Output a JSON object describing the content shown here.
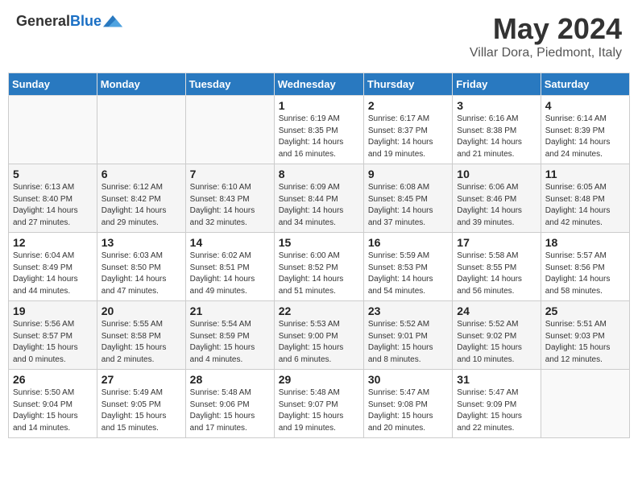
{
  "header": {
    "logo_line1": "General",
    "logo_line2": "Blue",
    "month": "May 2024",
    "location": "Villar Dora, Piedmont, Italy"
  },
  "weekdays": [
    "Sunday",
    "Monday",
    "Tuesday",
    "Wednesday",
    "Thursday",
    "Friday",
    "Saturday"
  ],
  "weeks": [
    [
      {
        "day": "",
        "info": ""
      },
      {
        "day": "",
        "info": ""
      },
      {
        "day": "",
        "info": ""
      },
      {
        "day": "1",
        "info": "Sunrise: 6:19 AM\nSunset: 8:35 PM\nDaylight: 14 hours\nand 16 minutes."
      },
      {
        "day": "2",
        "info": "Sunrise: 6:17 AM\nSunset: 8:37 PM\nDaylight: 14 hours\nand 19 minutes."
      },
      {
        "day": "3",
        "info": "Sunrise: 6:16 AM\nSunset: 8:38 PM\nDaylight: 14 hours\nand 21 minutes."
      },
      {
        "day": "4",
        "info": "Sunrise: 6:14 AM\nSunset: 8:39 PM\nDaylight: 14 hours\nand 24 minutes."
      }
    ],
    [
      {
        "day": "5",
        "info": "Sunrise: 6:13 AM\nSunset: 8:40 PM\nDaylight: 14 hours\nand 27 minutes."
      },
      {
        "day": "6",
        "info": "Sunrise: 6:12 AM\nSunset: 8:42 PM\nDaylight: 14 hours\nand 29 minutes."
      },
      {
        "day": "7",
        "info": "Sunrise: 6:10 AM\nSunset: 8:43 PM\nDaylight: 14 hours\nand 32 minutes."
      },
      {
        "day": "8",
        "info": "Sunrise: 6:09 AM\nSunset: 8:44 PM\nDaylight: 14 hours\nand 34 minutes."
      },
      {
        "day": "9",
        "info": "Sunrise: 6:08 AM\nSunset: 8:45 PM\nDaylight: 14 hours\nand 37 minutes."
      },
      {
        "day": "10",
        "info": "Sunrise: 6:06 AM\nSunset: 8:46 PM\nDaylight: 14 hours\nand 39 minutes."
      },
      {
        "day": "11",
        "info": "Sunrise: 6:05 AM\nSunset: 8:48 PM\nDaylight: 14 hours\nand 42 minutes."
      }
    ],
    [
      {
        "day": "12",
        "info": "Sunrise: 6:04 AM\nSunset: 8:49 PM\nDaylight: 14 hours\nand 44 minutes."
      },
      {
        "day": "13",
        "info": "Sunrise: 6:03 AM\nSunset: 8:50 PM\nDaylight: 14 hours\nand 47 minutes."
      },
      {
        "day": "14",
        "info": "Sunrise: 6:02 AM\nSunset: 8:51 PM\nDaylight: 14 hours\nand 49 minutes."
      },
      {
        "day": "15",
        "info": "Sunrise: 6:00 AM\nSunset: 8:52 PM\nDaylight: 14 hours\nand 51 minutes."
      },
      {
        "day": "16",
        "info": "Sunrise: 5:59 AM\nSunset: 8:53 PM\nDaylight: 14 hours\nand 54 minutes."
      },
      {
        "day": "17",
        "info": "Sunrise: 5:58 AM\nSunset: 8:55 PM\nDaylight: 14 hours\nand 56 minutes."
      },
      {
        "day": "18",
        "info": "Sunrise: 5:57 AM\nSunset: 8:56 PM\nDaylight: 14 hours\nand 58 minutes."
      }
    ],
    [
      {
        "day": "19",
        "info": "Sunrise: 5:56 AM\nSunset: 8:57 PM\nDaylight: 15 hours\nand 0 minutes."
      },
      {
        "day": "20",
        "info": "Sunrise: 5:55 AM\nSunset: 8:58 PM\nDaylight: 15 hours\nand 2 minutes."
      },
      {
        "day": "21",
        "info": "Sunrise: 5:54 AM\nSunset: 8:59 PM\nDaylight: 15 hours\nand 4 minutes."
      },
      {
        "day": "22",
        "info": "Sunrise: 5:53 AM\nSunset: 9:00 PM\nDaylight: 15 hours\nand 6 minutes."
      },
      {
        "day": "23",
        "info": "Sunrise: 5:52 AM\nSunset: 9:01 PM\nDaylight: 15 hours\nand 8 minutes."
      },
      {
        "day": "24",
        "info": "Sunrise: 5:52 AM\nSunset: 9:02 PM\nDaylight: 15 hours\nand 10 minutes."
      },
      {
        "day": "25",
        "info": "Sunrise: 5:51 AM\nSunset: 9:03 PM\nDaylight: 15 hours\nand 12 minutes."
      }
    ],
    [
      {
        "day": "26",
        "info": "Sunrise: 5:50 AM\nSunset: 9:04 PM\nDaylight: 15 hours\nand 14 minutes."
      },
      {
        "day": "27",
        "info": "Sunrise: 5:49 AM\nSunset: 9:05 PM\nDaylight: 15 hours\nand 15 minutes."
      },
      {
        "day": "28",
        "info": "Sunrise: 5:48 AM\nSunset: 9:06 PM\nDaylight: 15 hours\nand 17 minutes."
      },
      {
        "day": "29",
        "info": "Sunrise: 5:48 AM\nSunset: 9:07 PM\nDaylight: 15 hours\nand 19 minutes."
      },
      {
        "day": "30",
        "info": "Sunrise: 5:47 AM\nSunset: 9:08 PM\nDaylight: 15 hours\nand 20 minutes."
      },
      {
        "day": "31",
        "info": "Sunrise: 5:47 AM\nSunset: 9:09 PM\nDaylight: 15 hours\nand 22 minutes."
      },
      {
        "day": "",
        "info": ""
      }
    ]
  ]
}
